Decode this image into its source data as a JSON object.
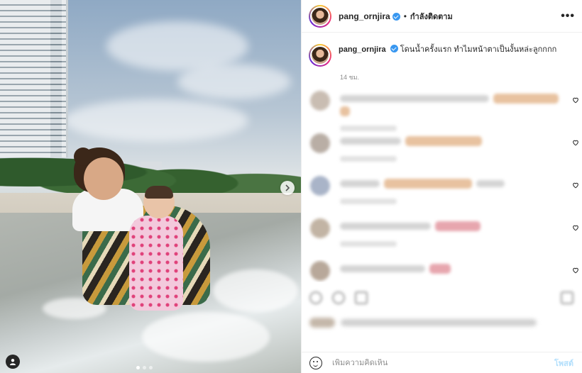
{
  "post": {
    "username": "pang_ornjira",
    "follow_state": "กำลังติดตาม",
    "separator": "•",
    "more_icon": "•••",
    "caption": "โดนน้ำครั้งแรก ทำไมหน้าตาเป็นงั้นหล่ะลูกกกก",
    "time_ago": "14 ชม."
  },
  "comment_box": {
    "placeholder": "เพิ่มความคิดเห็น",
    "post_label": "โพสต์"
  },
  "carousel": {
    "next_icon": "›",
    "dots_total": 3,
    "active_dot": 1
  },
  "colors": {
    "verified": "#3897f0",
    "post_button": "#b2dffc",
    "muted_text": "#8e8e8e"
  },
  "icons": [
    "verified-badge-icon",
    "more-options-icon",
    "heart-icon",
    "emoji-icon",
    "chevron-right-icon",
    "user-tag-icon"
  ]
}
